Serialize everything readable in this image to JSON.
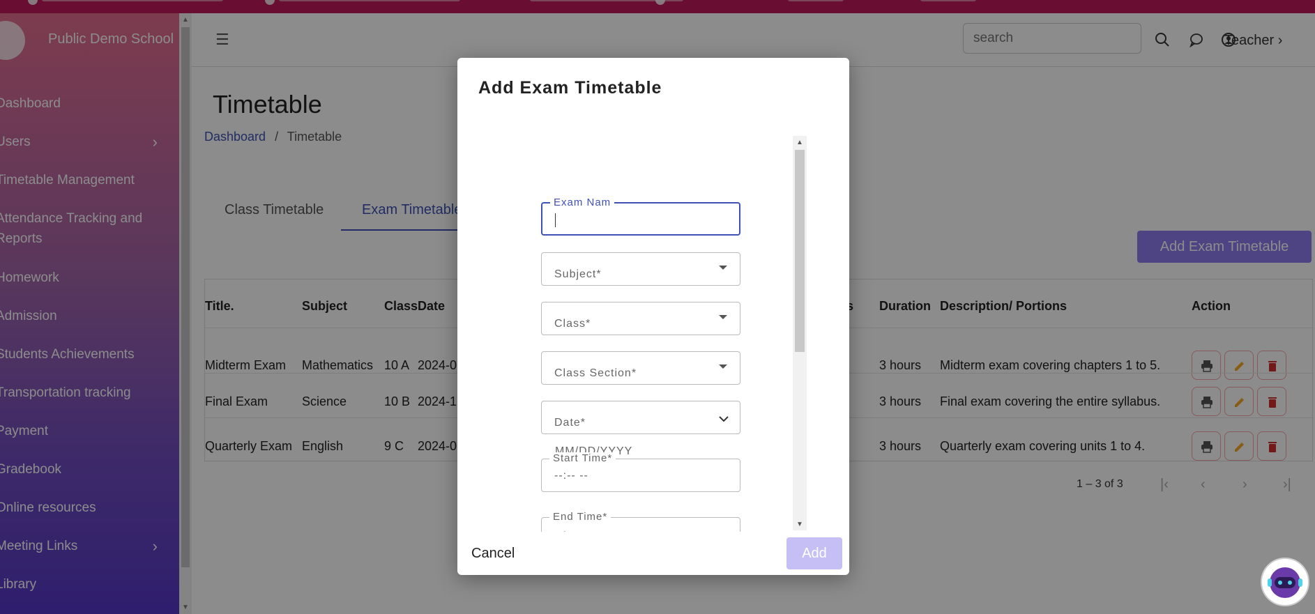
{
  "sidebar": {
    "school_name": "Public Demo School",
    "items": [
      {
        "label": "Dashboard"
      },
      {
        "label": "Users"
      },
      {
        "label": "Timetable Management"
      },
      {
        "label": "Attendance Tracking and Reports"
      },
      {
        "label": "Homework"
      },
      {
        "label": "Admission"
      },
      {
        "label": "Students Achievements"
      },
      {
        "label": "Transportation tracking"
      },
      {
        "label": "Payment"
      },
      {
        "label": "Gradebook"
      },
      {
        "label": "Online resources"
      },
      {
        "label": "Meeting Links"
      },
      {
        "label": "Library"
      }
    ]
  },
  "header": {
    "search_placeholder": "search",
    "user_role": "Teacher"
  },
  "page": {
    "title": "Timetable",
    "breadcrumb": {
      "home": "Dashboard",
      "separator": "/",
      "current": "Timetable"
    },
    "tabs": [
      {
        "label": "Class Timetable"
      },
      {
        "label": "Exam Timetable"
      }
    ],
    "add_button": "Add Exam Timetable"
  },
  "table": {
    "headers": [
      "Title.",
      "Subject",
      "Class",
      "Date",
      "ks",
      "Duration",
      "Description/ Portions",
      "Action"
    ],
    "rows": [
      {
        "title": "Midterm Exam",
        "subject": "Mathematics",
        "class": "10 A",
        "date": "2024-0",
        "duration": "3 hours",
        "description": "Midterm exam covering chapters 1 to 5."
      },
      {
        "title": "Final Exam",
        "subject": "Science",
        "class": "10 B",
        "date": "2024-1",
        "duration": "3 hours",
        "description": "Final exam covering the entire syllabus."
      },
      {
        "title": "Quarterly Exam",
        "subject": "English",
        "class": "9 C",
        "date": "2024-0",
        "duration": "3 hours",
        "description": "Quarterly exam covering units 1 to 4."
      }
    ],
    "pagination": "1 – 3 of 3"
  },
  "modal": {
    "title": "Add Exam Timetable",
    "fields": {
      "exam_name": {
        "label": "Exam Nam",
        "value": ""
      },
      "subject": {
        "label": "Subject*"
      },
      "class": {
        "label": "Class*"
      },
      "class_section": {
        "label": "Class Section*"
      },
      "date": {
        "label": "Date*",
        "helper": "MM/DD/YYYY"
      },
      "start_time": {
        "label": "Start Time*",
        "value": "--:-- --"
      },
      "end_time": {
        "label": "End Time*",
        "value": "--:-- --"
      }
    },
    "cancel_label": "Cancel",
    "add_label": "Add"
  },
  "colors": {
    "accent": "#3f51b5",
    "add_button": "#8e7cf0",
    "top_strip": "#c2185b",
    "delete": "#d32f2f",
    "edit": "#f9a825"
  }
}
